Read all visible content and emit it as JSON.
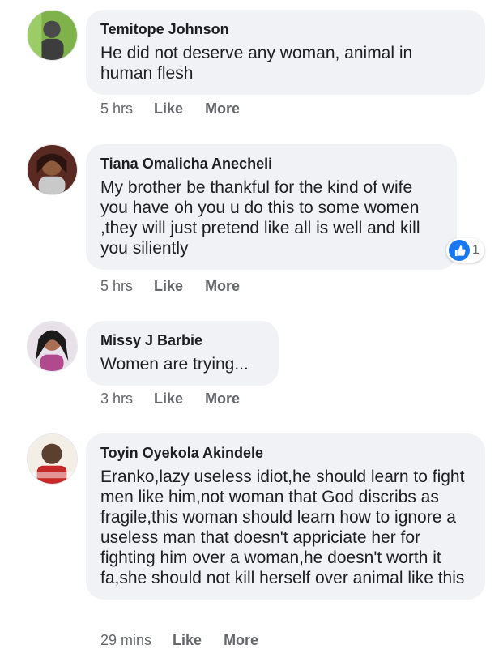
{
  "comments": [
    {
      "author": "Temitope Johnson",
      "text": "He did not deserve any woman, animal in human flesh",
      "time": "5 hrs",
      "like_label": "Like",
      "more_label": "More"
    },
    {
      "author": "Tiana Omalicha Anecheli",
      "text": "My brother be thankful for the kind of wife you have oh you u do this to some women ,they will just pretend like all is well and kill you siliently",
      "time": "5 hrs",
      "like_label": "Like",
      "more_label": "More",
      "reaction_count": "1"
    },
    {
      "author": "Missy J Barbie",
      "text": "Women are trying...",
      "time": "3 hrs",
      "like_label": "Like",
      "more_label": "More"
    },
    {
      "author": "Toyin Oyekola Akindele",
      "text": "Eranko,lazy useless idiot,he should learn to fight men like him,not woman that God discribs as fragile,this woman should learn how to ignore a useless man that doesn't appriciate her for fighting him over a woman,he doesn't worth it fa,she should not kill herself over animal like this",
      "time": "29 mins",
      "like_label": "Like",
      "more_label": "More"
    }
  ],
  "colors": {
    "bubble": "#f0f2f5",
    "meta_text": "#65676b",
    "like_badge": "#1877f2"
  }
}
